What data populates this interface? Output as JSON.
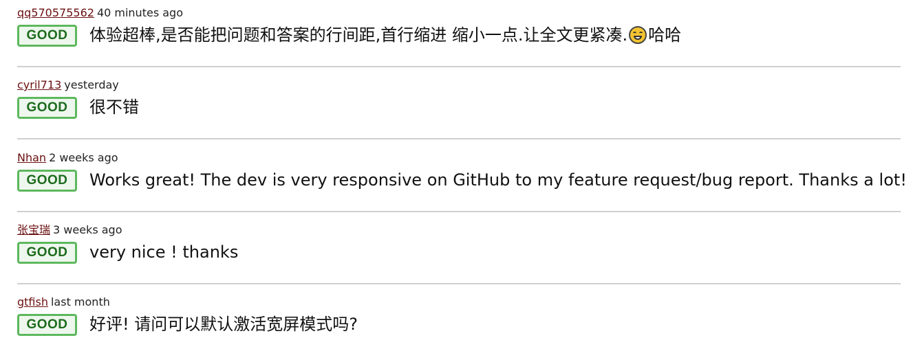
{
  "reviews": [
    {
      "author": "qq570575562",
      "time": "40 minutes ago",
      "rating": "GOOD",
      "text_before_emoji": "体验超棒,是否能把问题和答案的行间距,首行缩进 缩小一点.让全文更紧凑.",
      "emoji": "grinning-face",
      "text_after_emoji": "哈哈"
    },
    {
      "author": "cyril713",
      "time": "yesterday",
      "rating": "GOOD",
      "text": "很不错"
    },
    {
      "author": "Nhan",
      "time": "2 weeks ago",
      "rating": "GOOD",
      "text": "Works great! The dev is very responsive on GitHub to my feature request/bug report. Thanks a lot! :D"
    },
    {
      "author": "张宝瑞",
      "time": "3 weeks ago",
      "rating": "GOOD",
      "text": "very nice ! thanks"
    },
    {
      "author": "gtfish",
      "time": "last month",
      "rating": "GOOD",
      "text": "好评! 请问可以默认激活宽屏模式吗?"
    }
  ],
  "colors": {
    "author_link": "#6b0f0f",
    "badge_border": "#5cb85c",
    "badge_text": "#1d6b1d",
    "divider": "#cfcfcf"
  }
}
